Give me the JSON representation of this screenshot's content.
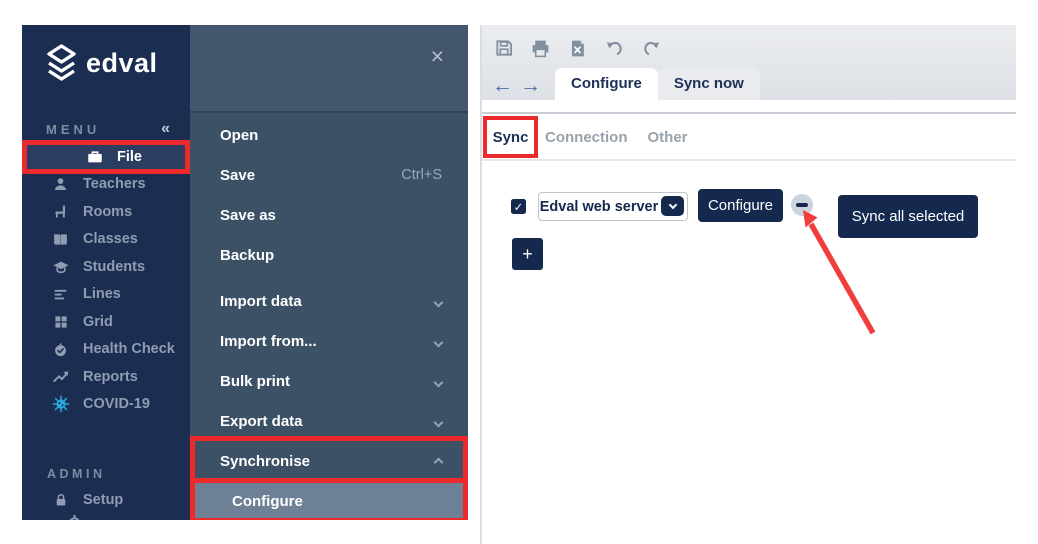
{
  "colors": {
    "sidebar_navy": "#1b2d50",
    "flyout_slate": "#3d5166",
    "selected_flyout_item": "#6d8096",
    "active_sidebar_item": "#2b3e61",
    "button_navy": "#14294d",
    "highlight_red": "#ec2a2b",
    "arrow_red": "#f23d3d",
    "covid_blue": "#2aa9e0",
    "nav_arrow_blue": "#4b6da6"
  },
  "sidebar": {
    "logo_text": "edval",
    "menu_label": "MENU",
    "items": [
      {
        "label": "File",
        "icon": "briefcase-icon",
        "active": true,
        "highlighted": true
      },
      {
        "label": "Teachers",
        "icon": "person-icon"
      },
      {
        "label": "Rooms",
        "icon": "chair-icon"
      },
      {
        "label": "Classes",
        "icon": "book-icon"
      },
      {
        "label": "Students",
        "icon": "graduation-cap-icon"
      },
      {
        "label": "Lines",
        "icon": "lines-icon"
      },
      {
        "label": "Grid",
        "icon": "grid-icon"
      },
      {
        "label": "Health Check",
        "icon": "health-check-icon"
      },
      {
        "label": "Reports",
        "icon": "trend-icon"
      },
      {
        "label": "COVID-19",
        "icon": "virus-icon"
      }
    ],
    "admin_label": "ADMIN",
    "admin_items": [
      {
        "label": "Setup",
        "icon": "lock-icon"
      }
    ]
  },
  "flyout": {
    "items": [
      {
        "label": "Open"
      },
      {
        "label": "Save",
        "shortcut": "Ctrl+S"
      },
      {
        "label": "Save as"
      },
      {
        "label": "Backup"
      },
      {
        "label": "Import data",
        "chevron": "down"
      },
      {
        "label": "Import from...",
        "chevron": "down"
      },
      {
        "label": "Bulk print",
        "chevron": "down"
      },
      {
        "label": "Export data",
        "chevron": "down"
      },
      {
        "label": "Synchronise",
        "chevron": "up",
        "highlighted": true
      },
      {
        "label": "Configure",
        "selected": true,
        "highlighted": true
      }
    ]
  },
  "toolbar": {
    "icons": [
      "save-icon",
      "print-icon",
      "export-excel-icon",
      "undo-icon",
      "redo-icon"
    ],
    "tabs": [
      {
        "label": "Configure",
        "active": true
      },
      {
        "label": "Sync now",
        "active": false
      }
    ]
  },
  "subtabs": [
    {
      "label": "Sync",
      "active": true,
      "highlighted": true
    },
    {
      "label": "Connection",
      "active": false
    },
    {
      "label": "Other",
      "active": false
    }
  ],
  "sync_panel": {
    "server_checkbox_checked": true,
    "server_dropdown_value": "Edval web server",
    "configure_button_label": "Configure",
    "sync_all_button_label": "Sync all selected",
    "add_button_label": "+"
  },
  "glyphs": {
    "collapse": "«",
    "close": "×",
    "back": "←",
    "forward": "→",
    "check": "✓"
  }
}
